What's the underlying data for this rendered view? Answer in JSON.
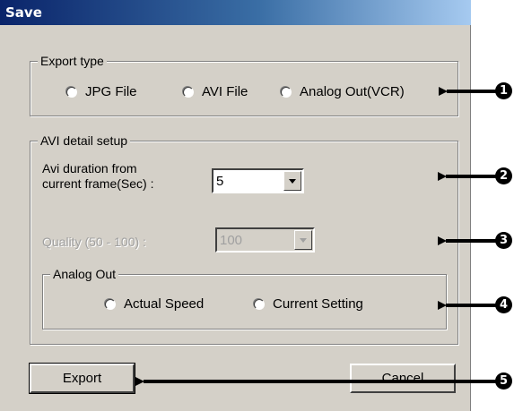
{
  "window": {
    "title": "Save"
  },
  "export_type": {
    "legend": "Export type",
    "options": [
      "JPG File",
      "AVI File",
      "Analog Out(VCR)"
    ]
  },
  "avi_setup": {
    "legend": "AVI detail setup",
    "duration_label_line1": "Avi duration from",
    "duration_label_line2": "current frame(Sec) :",
    "duration_value": "5",
    "quality_label": "Quality (50 - 100) :",
    "quality_value": "100"
  },
  "analog_out": {
    "legend": "Analog Out",
    "options": [
      "Actual Speed",
      "Current Setting"
    ]
  },
  "buttons": {
    "export": "Export",
    "cancel": "Cancel"
  },
  "callouts": [
    "1",
    "2",
    "3",
    "4",
    "5"
  ]
}
